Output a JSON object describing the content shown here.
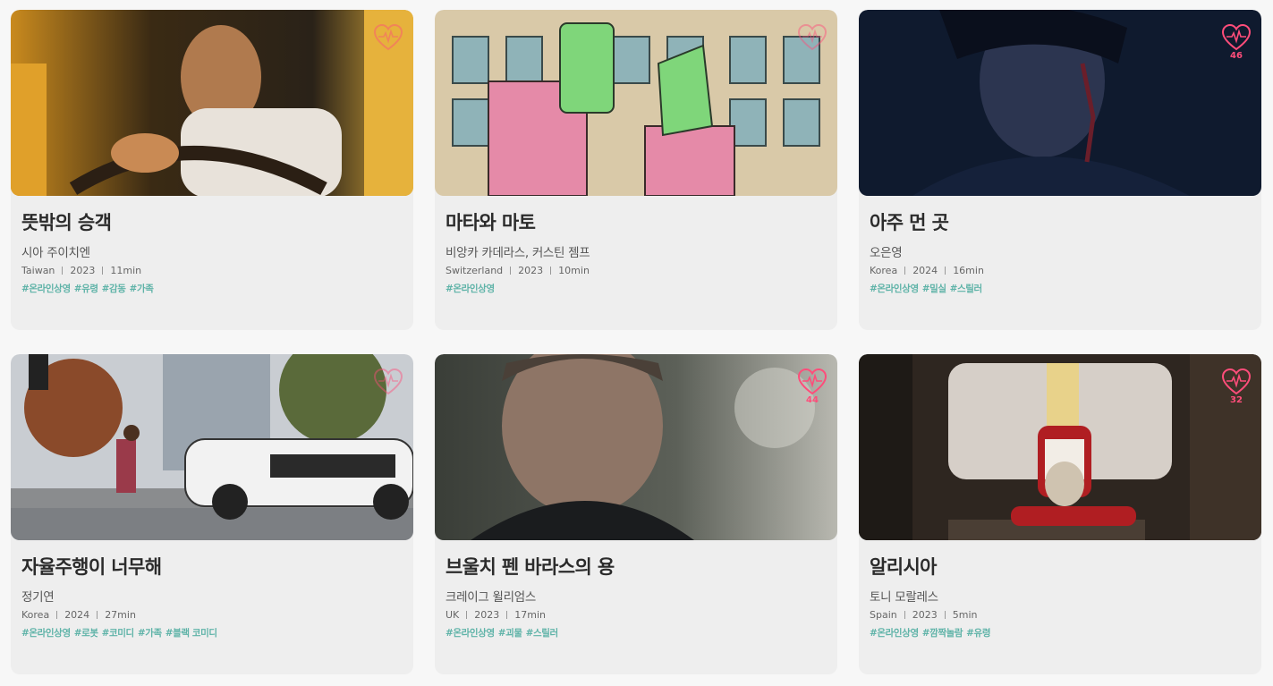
{
  "colors": {
    "accent_tag": "#5fb3a8",
    "like": "#ff4d7a",
    "card_bg": "#eeeeee"
  },
  "films": [
    {
      "title": "뜻밖의 승객",
      "director": "시아 주이치엔",
      "country": "Taiwan",
      "year": "2023",
      "runtime": "11min",
      "tags": [
        "#온라인상영",
        "#유령",
        "#감동",
        "#가족"
      ],
      "likes": "",
      "image": "car-driver-night"
    },
    {
      "title": "마타와 마토",
      "director": "비앙카 카데라스, 커스틴 젬프",
      "country": "Switzerland",
      "year": "2023",
      "runtime": "10min",
      "tags": [
        "#온라인상영"
      ],
      "likes": "",
      "image": "animated-green-characters"
    },
    {
      "title": "아주 먼 곳",
      "director": "오은영",
      "country": "Korea",
      "year": "2024",
      "runtime": "16min",
      "tags": [
        "#온라인상영",
        "#밀실",
        "#스릴러"
      ],
      "likes": "46",
      "image": "bloodied-man-dark"
    },
    {
      "title": "자율주행이 너무해",
      "director": "정기연",
      "country": "Korea",
      "year": "2024",
      "runtime": "27min",
      "tags": [
        "#온라인상영",
        "#로봇",
        "#코미디",
        "#가족",
        "#블랙 코미디"
      ],
      "likes": "",
      "image": "autonomous-car-street"
    },
    {
      "title": "브울치 펜 바라스의 용",
      "director": "크레이그 윌리엄스",
      "country": "UK",
      "year": "2023",
      "runtime": "17min",
      "tags": [
        "#온라인상영",
        "#괴물",
        "#스릴러"
      ],
      "likes": "44",
      "image": "old-man-portrait"
    },
    {
      "title": "알리시아",
      "director": "토니 모랄레스",
      "country": "Spain",
      "year": "2023",
      "runtime": "5min",
      "tags": [
        "#온라인상영",
        "#깜짝놀람",
        "#유령"
      ],
      "likes": "32",
      "image": "girl-with-rabbit"
    }
  ]
}
